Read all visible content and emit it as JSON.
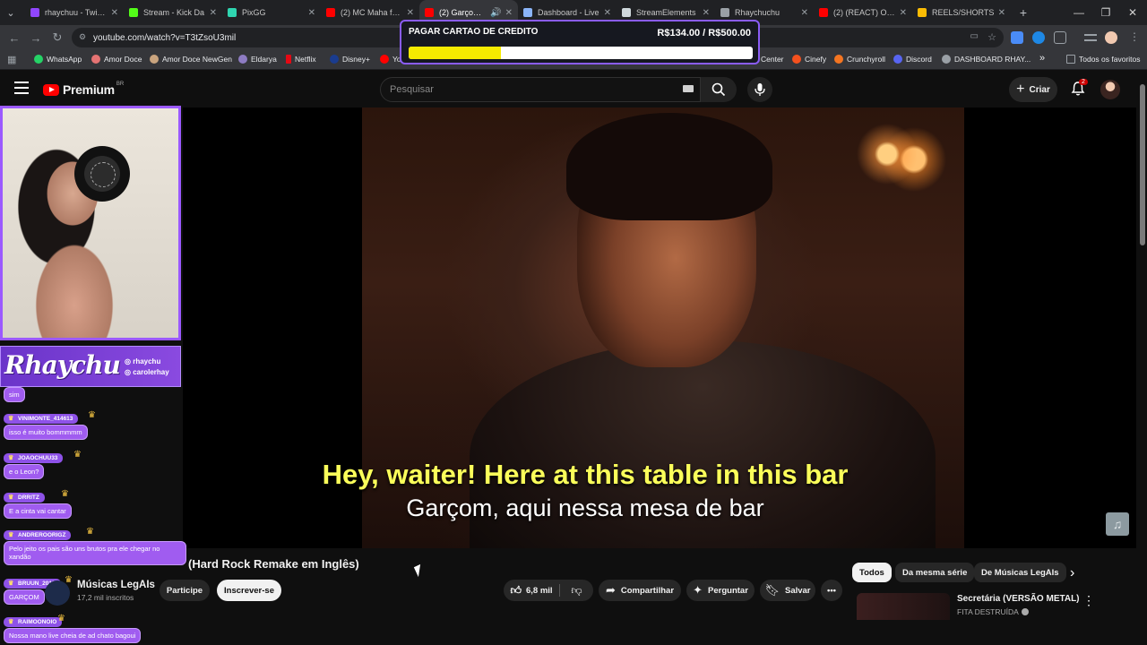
{
  "browser": {
    "tabs": [
      {
        "label": "rhaychuu - Twitch",
        "color": "#9146ff"
      },
      {
        "label": "Stream - Kick Da",
        "color": "#53fc18"
      },
      {
        "label": "PixGG",
        "color": "#2fd5b0"
      },
      {
        "label": "(2) MC Maha feat",
        "color": "#ff0000"
      },
      {
        "label": "(2) Garçom - I",
        "color": "#ff0000"
      },
      {
        "label": "Dashboard - Live",
        "color": "#8ab4f8"
      },
      {
        "label": "StreamElements",
        "color": "#cfd8dc"
      },
      {
        "label": "Rhaychuchu",
        "color": "#9aa0a6"
      },
      {
        "label": "(2) (REACT) O qu",
        "color": "#ff0000"
      },
      {
        "label": "REELS/SHORTS",
        "color": "#fbbc04"
      }
    ],
    "url": "youtube.com/watch?v=T3tZsoU3mil",
    "bookmarks_left": [
      "WhatsApp",
      "Amor Doce",
      "Amor Doce NewGen",
      "Eldarya",
      "Netflix",
      "Disney+",
      "Yo"
    ],
    "bookmarks_right": [
      "Center",
      "Cinefy",
      "Crunchyroll",
      "Discord",
      "DASHBOARD RHAY..."
    ],
    "bookmarks_all": "Todos os favoritos"
  },
  "donation": {
    "label": "PAGAR CARTAO DE CREDITO",
    "amount": "R$134.00 / R$500.00",
    "progress": 0.268
  },
  "youtube": {
    "logo_text": "Premium",
    "logo_region": "BR",
    "search_placeholder": "Pesquisar",
    "create_label": "Criar",
    "notification_count": "2"
  },
  "video": {
    "subtitle_en": "Hey, waiter! Here at this table in this bar",
    "subtitle_pt": "Garçom, aqui nessa mesa de bar",
    "title": "(Hard Rock Remake em Inglês)"
  },
  "channel": {
    "name": "Músicas LegAIs",
    "subscribers": "17,2 mil inscritos",
    "join_label": "Participe",
    "subscribe_label": "Inscrever-se"
  },
  "actions": {
    "likes": "6,8 mil",
    "share": "Compartilhar",
    "ask": "Perguntar",
    "save": "Salvar"
  },
  "recommendations": {
    "chips": [
      "Todos",
      "Da mesma série",
      "De Músicas LegAIs"
    ],
    "first_title": "Secretária (VERSÃO METAL)",
    "first_channel": "FITA DESTRUÍDA"
  },
  "stream_overlay": {
    "brand_name": "Rhaychu",
    "handles": [
      "rhaychu",
      "carolerhay"
    ],
    "chat": [
      {
        "user": "",
        "message": "sim"
      },
      {
        "user": "VINIMONTE_414613",
        "message": "isso é muito bommmmm"
      },
      {
        "user": "JOAOCHUU33",
        "message": "e o Leon?"
      },
      {
        "user": "DRRITZ",
        "message": "E a cinta vai cantar"
      },
      {
        "user": "ANDREROORIGZ",
        "message": "Pelo jeito os pais são uns brutos pra ele chegar no xandão"
      },
      {
        "user": "BRUUN_2018",
        "message": "GARÇOM"
      },
      {
        "user": "RAIMOONOIO",
        "message": "Nossa mano live cheia de ad chato bagoui"
      }
    ]
  }
}
